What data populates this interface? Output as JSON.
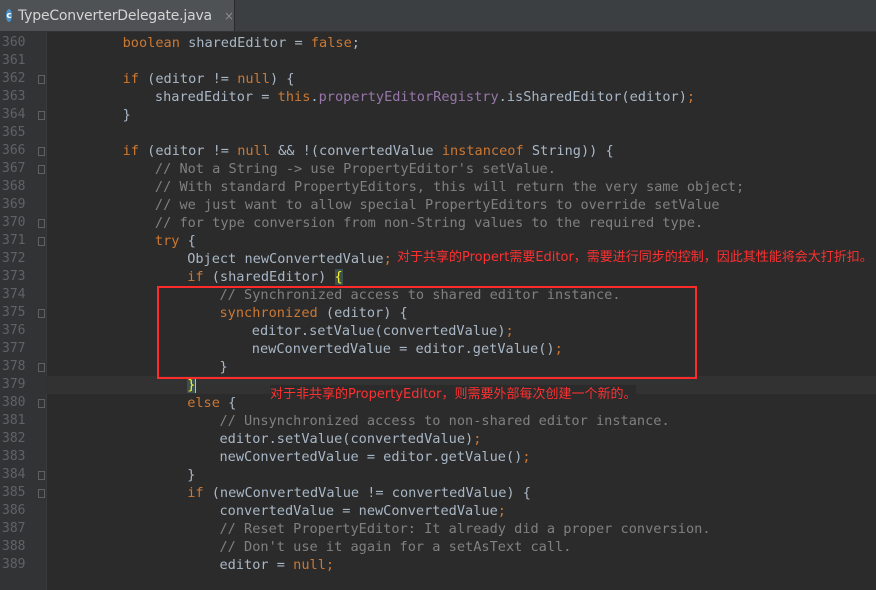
{
  "tab": {
    "filename": "TypeConverterDelegate.java",
    "icon": "c-class-icon",
    "close": "×"
  },
  "colors": {
    "keyword": "#cc7832",
    "comment": "#808080",
    "field": "#9876aa",
    "text": "#a9b7c6",
    "annotation": "#ff3030"
  },
  "lines": [
    {
      "num": "360",
      "indent": 2,
      "tokens": [
        [
          "kw",
          "boolean"
        ],
        [
          "p",
          " sharedEditor = "
        ],
        [
          "kw",
          "false"
        ],
        [
          "p",
          ";"
        ]
      ]
    },
    {
      "num": "361",
      "indent": 0,
      "tokens": []
    },
    {
      "num": "362",
      "indent": 2,
      "tokens": [
        [
          "kw",
          "if"
        ],
        [
          "p",
          " (editor != "
        ],
        [
          "kw",
          "null"
        ],
        [
          "p",
          ") {"
        ]
      ]
    },
    {
      "num": "363",
      "indent": 3,
      "tokens": [
        [
          "p",
          "sharedEditor = "
        ],
        [
          "kw",
          "this"
        ],
        [
          "p",
          "."
        ],
        [
          "fd",
          "propertyEditorRegistry"
        ],
        [
          "p",
          ".isSharedEditor(editor)"
        ],
        [
          "kw",
          ";"
        ]
      ]
    },
    {
      "num": "364",
      "indent": 2,
      "tokens": [
        [
          "p",
          "}"
        ]
      ]
    },
    {
      "num": "365",
      "indent": 0,
      "tokens": []
    },
    {
      "num": "366",
      "indent": 2,
      "tokens": [
        [
          "kw",
          "if"
        ],
        [
          "p",
          " (editor != "
        ],
        [
          "kw",
          "null"
        ],
        [
          "p",
          " && !(convertedValue "
        ],
        [
          "kw",
          "instanceof"
        ],
        [
          "p",
          " String)) {"
        ]
      ]
    },
    {
      "num": "367",
      "indent": 3,
      "tokens": [
        [
          "cm",
          "// Not a String -> use PropertyEditor's setValue."
        ]
      ]
    },
    {
      "num": "368",
      "indent": 3,
      "tokens": [
        [
          "cm",
          "// With standard PropertyEditors, this will return the very same object;"
        ]
      ]
    },
    {
      "num": "369",
      "indent": 3,
      "tokens": [
        [
          "cm",
          "// we just want to allow special PropertyEditors to override setValue"
        ]
      ]
    },
    {
      "num": "370",
      "indent": 3,
      "tokens": [
        [
          "cm",
          "// for type conversion from non-String values to the required type."
        ]
      ]
    },
    {
      "num": "371",
      "indent": 3,
      "tokens": [
        [
          "kw",
          "try"
        ],
        [
          "p",
          " {"
        ]
      ]
    },
    {
      "num": "372",
      "indent": 4,
      "tokens": [
        [
          "p",
          "Object newConvertedValue"
        ],
        [
          "kw",
          ";"
        ]
      ]
    },
    {
      "num": "373",
      "indent": 4,
      "tokens": [
        [
          "kw",
          "if"
        ],
        [
          "p",
          " (sharedEditor) "
        ],
        [
          "bh",
          "{"
        ]
      ]
    },
    {
      "num": "374",
      "indent": 5,
      "tokens": [
        [
          "cm",
          "// Synchronized access to shared editor instance."
        ]
      ]
    },
    {
      "num": "375",
      "indent": 5,
      "tokens": [
        [
          "kw",
          "synchronized"
        ],
        [
          "p",
          " (editor) {"
        ]
      ]
    },
    {
      "num": "376",
      "indent": 6,
      "tokens": [
        [
          "p",
          "editor.setValue(convertedValue)"
        ],
        [
          "kw",
          ";"
        ]
      ]
    },
    {
      "num": "377",
      "indent": 6,
      "tokens": [
        [
          "p",
          "newConvertedValue = editor.getValue()"
        ],
        [
          "kw",
          ";"
        ]
      ]
    },
    {
      "num": "378",
      "indent": 5,
      "tokens": [
        [
          "p",
          "}"
        ]
      ]
    },
    {
      "num": "379",
      "indent": 4,
      "tokens": [
        [
          "bh",
          "}"
        ]
      ]
    },
    {
      "num": "380",
      "indent": 4,
      "tokens": [
        [
          "kw",
          "else"
        ],
        [
          "p",
          " {"
        ]
      ]
    },
    {
      "num": "381",
      "indent": 5,
      "tokens": [
        [
          "cm",
          "// Unsynchronized access to non-shared editor instance."
        ]
      ]
    },
    {
      "num": "382",
      "indent": 5,
      "tokens": [
        [
          "p",
          "editor.setValue(convertedValue)"
        ],
        [
          "kw",
          ";"
        ]
      ]
    },
    {
      "num": "383",
      "indent": 5,
      "tokens": [
        [
          "p",
          "newConvertedValue = editor.getValue()"
        ],
        [
          "kw",
          ";"
        ]
      ]
    },
    {
      "num": "384",
      "indent": 4,
      "tokens": [
        [
          "p",
          "}"
        ]
      ]
    },
    {
      "num": "385",
      "indent": 4,
      "tokens": [
        [
          "kw",
          "if"
        ],
        [
          "p",
          " (newConvertedValue != convertedValue) {"
        ]
      ]
    },
    {
      "num": "386",
      "indent": 5,
      "tokens": [
        [
          "p",
          "convertedValue = newConvertedValue"
        ],
        [
          "kw",
          ";"
        ]
      ]
    },
    {
      "num": "387",
      "indent": 5,
      "tokens": [
        [
          "cm",
          "// Reset PropertyEditor: It already did a proper conversion."
        ]
      ]
    },
    {
      "num": "388",
      "indent": 5,
      "tokens": [
        [
          "cm",
          "// Don't use it again for a setAsText call."
        ]
      ]
    },
    {
      "num": "389",
      "indent": 5,
      "tokens": [
        [
          "p",
          "editor = "
        ],
        [
          "kw",
          "null"
        ],
        [
          "kw",
          ";"
        ]
      ]
    }
  ],
  "annotations": {
    "shared": "对于共享的Propert需要Editor，需要进行同步的控制，因此其性能将会大打折扣。",
    "nonshared": "对于非共享的PropertyEditor，则需要外部每次创建一个新的。"
  }
}
